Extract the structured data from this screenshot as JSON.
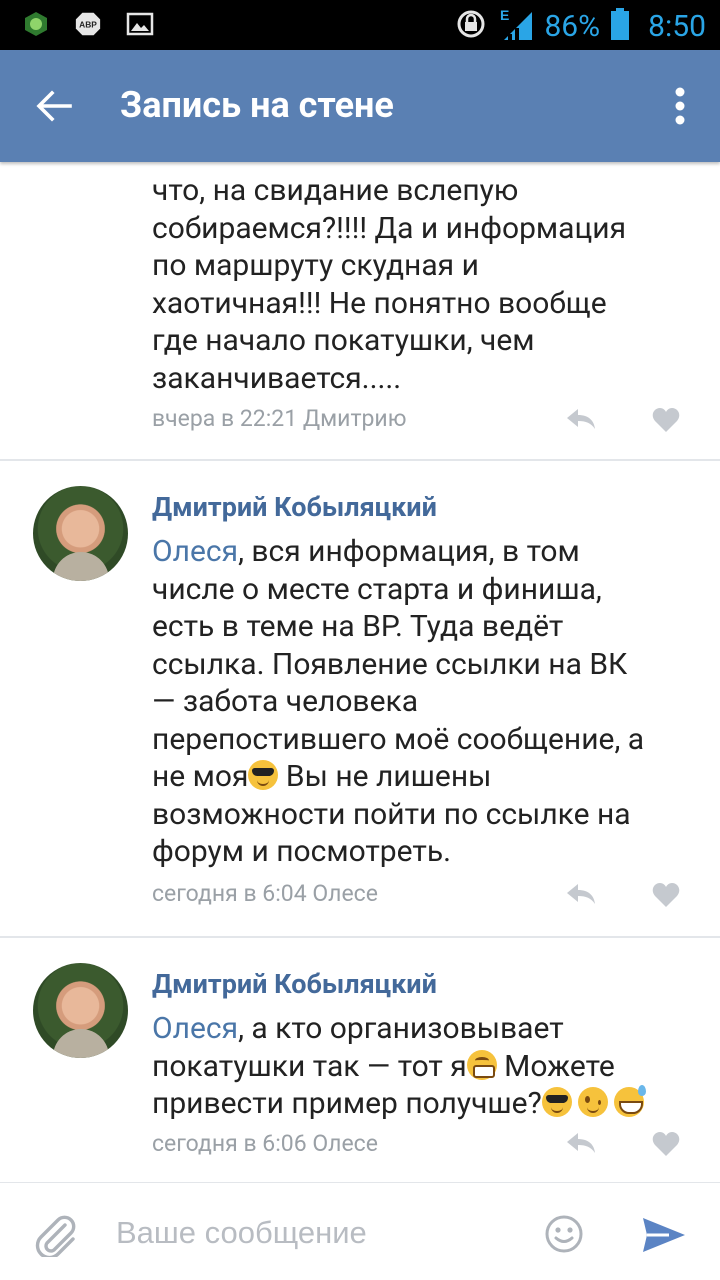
{
  "status_bar": {
    "battery_percent": "86%",
    "time": "8:50",
    "network_type": "E",
    "icons": [
      "game-app-icon",
      "adblock-icon",
      "picture-icon",
      "sync-icon",
      "signal-icon",
      "battery-icon"
    ],
    "accent_color": "#2aa5e6"
  },
  "app_bar": {
    "title": "Запись на стене",
    "background_color": "#5a80b3",
    "back_icon": "arrow-left-icon",
    "menu_icon": "more-vertical-icon"
  },
  "comments": [
    {
      "truncated_top": true,
      "text_lines": [
        "что, на свидание вслепую",
        "собираемся?!!!! Да и информация",
        "по маршруту скудная и",
        "хаотичная!!! Не понятно  вообще",
        "где начало покатушки, чем",
        "заканчивается....."
      ],
      "meta": "вчера в 22:21 Дмитрию"
    },
    {
      "author": "Дмитрий Кобыляцкий",
      "mention": "Олеся",
      "text_first": ", вся информация, в том",
      "text_lines": [
        "числе о месте старта и финиша,",
        "есть в теме на ВР. Туда ведёт",
        "ссылка. Появление ссылки на ВК",
        "— забота человека",
        "перепостившего моё сообщение, а"
      ],
      "line_with_emoji_before": "не моя",
      "line_with_emoji_after": " Вы не лишены",
      "text_lines_end": [
        "возможности пойти по ссылке на",
        "форум и посмотреть."
      ],
      "meta": "сегодня в 6:04 Олесе"
    },
    {
      "author": "Дмитрий Кобыляцкий",
      "mention": "Олеся",
      "text_first": ", а кто организовывает",
      "line2_before": "покатушки так — тот я",
      "line2_after": " Можете",
      "line3": "привести пример получше?",
      "meta": "сегодня в 6:06 Олесе"
    }
  ],
  "composer": {
    "placeholder": "Ваше сообщение",
    "attach_icon": "paperclip-icon",
    "emoji_icon": "smiley-icon",
    "send_icon": "send-icon"
  }
}
